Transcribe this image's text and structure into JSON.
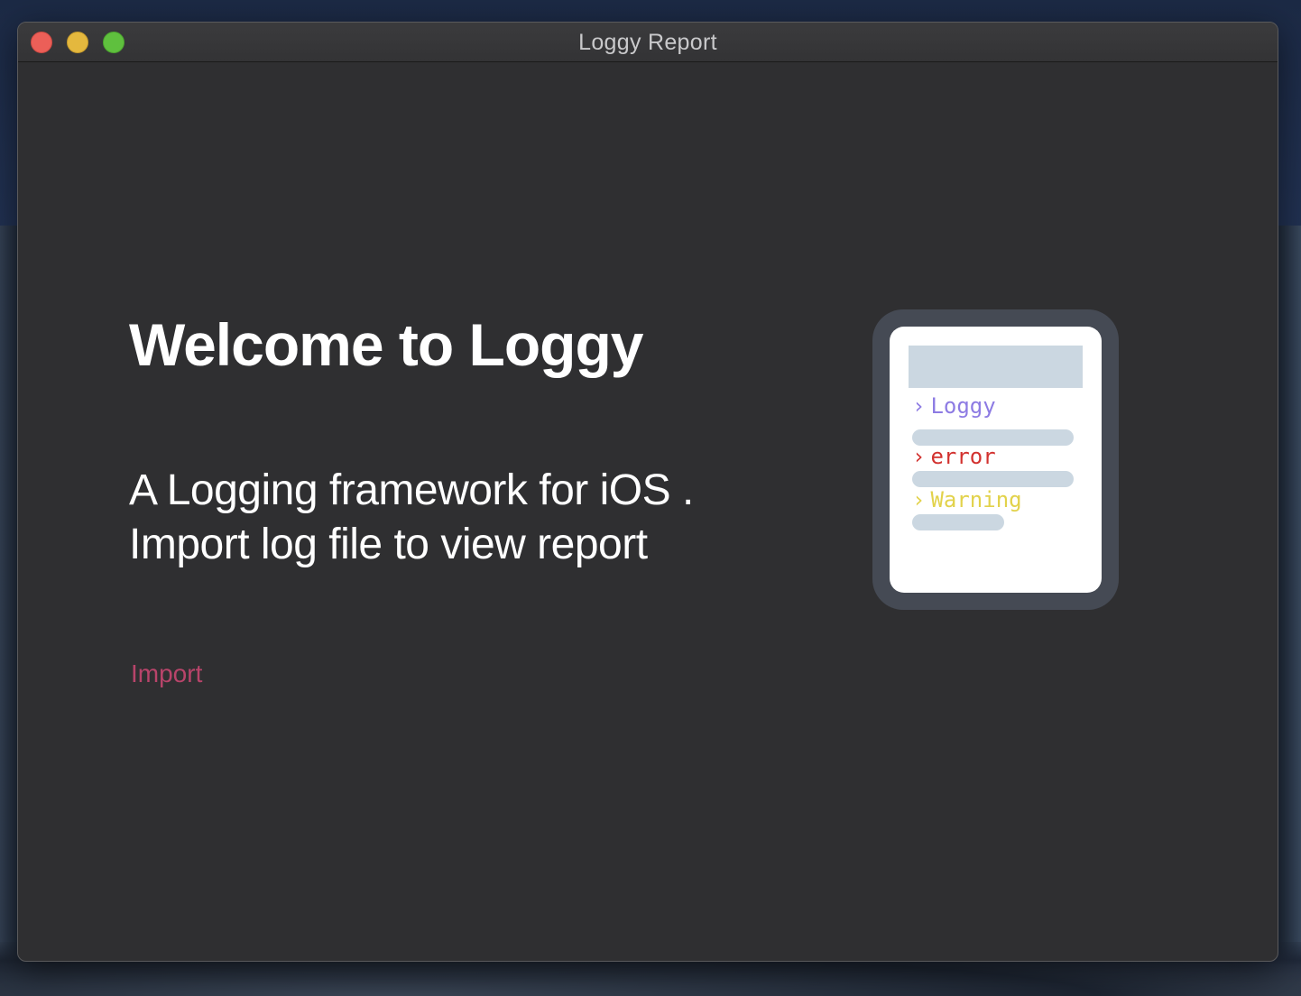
{
  "window": {
    "title": "Loggy Report"
  },
  "welcome": {
    "heading": "Welcome to Loggy",
    "subtitle_line1": "A Logging framework for iOS .",
    "subtitle_line2": "Import log file to view report",
    "import_label": "Import"
  },
  "illustration": {
    "lines": [
      {
        "chevron": "›",
        "label": "Loggy",
        "color": "#8d7be3"
      },
      {
        "chevron": "›",
        "label": "error",
        "color": "#d2322f"
      },
      {
        "chevron": "›",
        "label": "Warning",
        "color": "#e2d24b"
      }
    ]
  },
  "colors": {
    "accent": "#b8446a",
    "window_bg": "#2f2f31",
    "close": "#ec5f58",
    "minimize": "#e4b83e",
    "zoom": "#5fc03e"
  },
  "icons": {
    "close": "close-dot-icon",
    "minimize": "minimize-dot-icon",
    "zoom": "zoom-dot-icon",
    "chevron": "chevron-right-icon"
  }
}
